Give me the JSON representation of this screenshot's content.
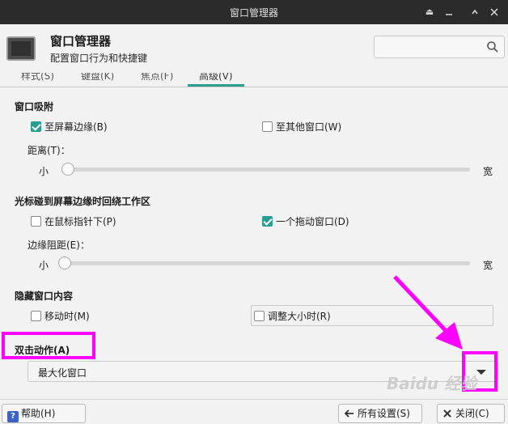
{
  "window": {
    "title": "窗口管理器",
    "buttons": {
      "shade_icon": "shade-icon",
      "minimize_icon": "minimize-icon",
      "maximize_icon": "maximize-icon",
      "close_icon": "close-icon"
    }
  },
  "header": {
    "title": "窗口管理器",
    "subtitle": "配置窗口行为和快捷键",
    "search_placeholder": ""
  },
  "tabs": [
    {
      "label": "样式(S)"
    },
    {
      "label": "键盘(K)"
    },
    {
      "label": "焦点(F)"
    },
    {
      "label": "高级(V)",
      "active": true
    }
  ],
  "window_snapping": {
    "title": "窗口吸附",
    "to_screen_edge": {
      "label": "至屏幕边缘(B)",
      "checked": true
    },
    "to_other_windows": {
      "label": "至其他窗口(W)",
      "checked": false
    },
    "distance_label": "距离(T)：",
    "slider_min": "小",
    "slider_max": "宽",
    "slider_value": 0
  },
  "wrap_workspaces": {
    "title": "光标碰到屏幕边缘时回绕工作区",
    "with_mouse_pointer": {
      "label": "在鼠标指针下(P)",
      "checked": false
    },
    "with_dragged_window": {
      "label": "一个拖动窗口(D)",
      "checked": true
    },
    "edge_resistance_label": "边缘阻距(E)：",
    "slider_min": "小",
    "slider_max": "宽",
    "slider_value": 0
  },
  "hide_content": {
    "title": "隐藏窗口内容",
    "on_move": {
      "label": "移动时(M)",
      "checked": false
    },
    "on_resize": {
      "label": "调整大小时(R)",
      "checked": false
    }
  },
  "double_click": {
    "title": "双击动作(A)",
    "selected": "最大化窗口"
  },
  "footer": {
    "help": "帮助(H)",
    "all_settings": "所有设置(S)",
    "close": "关闭(C)"
  },
  "colors": {
    "accent": "#2a9d8f",
    "annotation": "#ff00ff",
    "titlebar": "#2b2b2b"
  },
  "watermark": "Baidu 经验"
}
